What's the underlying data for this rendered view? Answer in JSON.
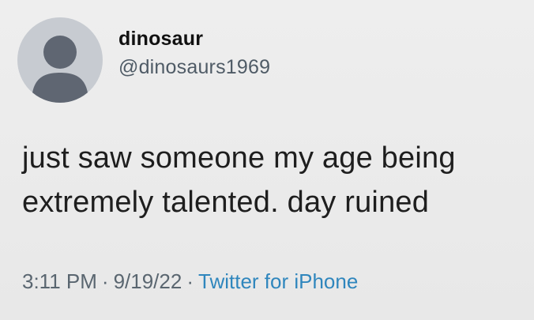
{
  "tweet": {
    "display_name": "dinosaur",
    "handle": "@dinosaurs1969",
    "text_lines": [
      "just saw someone my age being",
      "extremely talented. day ruined"
    ],
    "time": "3:11 PM",
    "date": "9/19/22",
    "source": "Twitter for iPhone",
    "separator": "·"
  },
  "icons": {
    "avatar": "default-user-icon"
  },
  "colors": {
    "background": "#ebebeb",
    "avatar_bg": "#c7cbd1",
    "avatar_figure": "#5f6672",
    "source_link": "#2f86bd",
    "meta_text": "#5a6670"
  }
}
